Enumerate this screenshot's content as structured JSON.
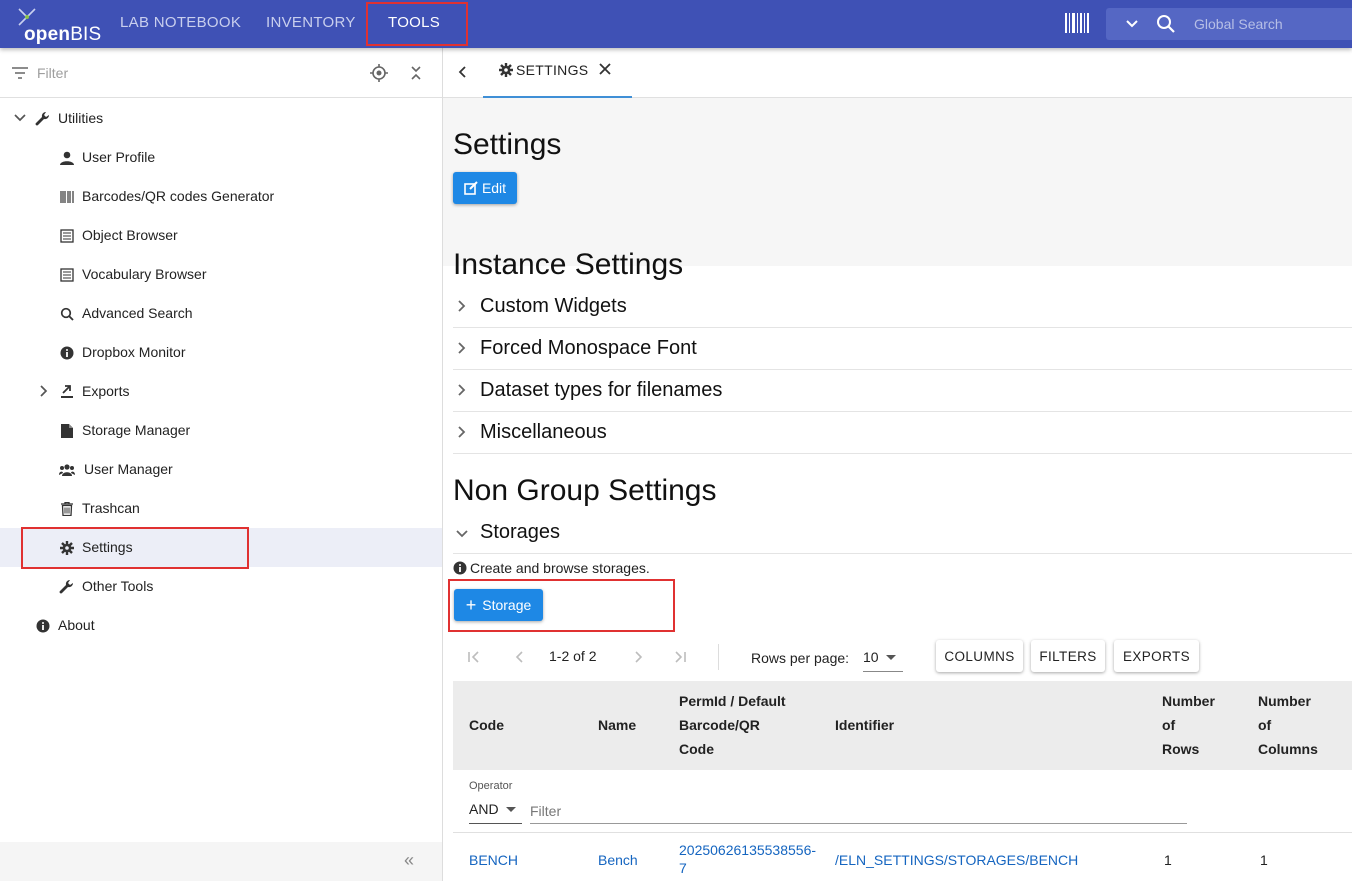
{
  "topbar": {
    "logo_text_bold": "open",
    "logo_text_light": "BIS",
    "nav": [
      {
        "label": "LAB NOTEBOOK"
      },
      {
        "label": "INVENTORY"
      },
      {
        "label": "TOOLS"
      }
    ],
    "search_placeholder": "Global Search",
    "accent": "#3f51b5"
  },
  "sidebar": {
    "filter_placeholder": "Filter",
    "items": [
      {
        "label": "Utilities",
        "icon": "wrench-icon"
      },
      {
        "label": "User Profile",
        "icon": "user-icon"
      },
      {
        "label": "Barcodes/QR codes Generator",
        "icon": "barcode-icon"
      },
      {
        "label": "Object Browser",
        "icon": "list-icon"
      },
      {
        "label": "Vocabulary Browser",
        "icon": "list-icon"
      },
      {
        "label": "Advanced Search",
        "icon": "search-icon"
      },
      {
        "label": "Dropbox Monitor",
        "icon": "info-icon"
      },
      {
        "label": "Exports",
        "icon": "export-icon"
      },
      {
        "label": "Storage Manager",
        "icon": "file-icon"
      },
      {
        "label": "User Manager",
        "icon": "users-icon"
      },
      {
        "label": "Trashcan",
        "icon": "trash-icon"
      },
      {
        "label": "Settings",
        "icon": "gear-icon"
      },
      {
        "label": "Other Tools",
        "icon": "wrench-icon"
      },
      {
        "label": "About",
        "icon": "info-icon"
      }
    ],
    "collapse_glyph": "«"
  },
  "main": {
    "tab_label": "SETTINGS",
    "page_title": "Settings",
    "edit_label": "Edit",
    "instance_title": "Instance Settings",
    "instance_sections": [
      "Custom Widgets",
      "Forced Monospace Font",
      "Dataset types for filenames",
      "Miscellaneous"
    ],
    "non_group_title": "Non Group Settings",
    "storages_label": "Storages",
    "info_text": "Create and browse storages.",
    "add_storage_label": "Storage"
  },
  "grid": {
    "range": "1-2 of 2",
    "rows_per_page_label": "Rows per page:",
    "rows_per_page_value": "10",
    "buttons": {
      "columns": "COLUMNS",
      "filters": "FILTERS",
      "exports": "EXPORTS"
    },
    "headers": {
      "code": "Code",
      "name": "Name",
      "permid_1": "PermId / Default",
      "permid_2": "Barcode/QR",
      "permid_3": "Code",
      "identifier": "Identifier",
      "rows_1": "Number",
      "rows_2": "of",
      "rows_3": "Rows",
      "cols_1": "Number",
      "cols_2": "of",
      "cols_3": "Columns"
    },
    "operator_label": "Operator",
    "operator_value": "AND",
    "filter_placeholder": "Filter",
    "rows": [
      {
        "code": "BENCH",
        "name": "Bench",
        "permid_1": "20250626135538556-",
        "permid_2": "7",
        "identifier": "/ELN_SETTINGS/STORAGES/BENCH",
        "num_rows": "1",
        "num_cols": "1"
      }
    ]
  }
}
